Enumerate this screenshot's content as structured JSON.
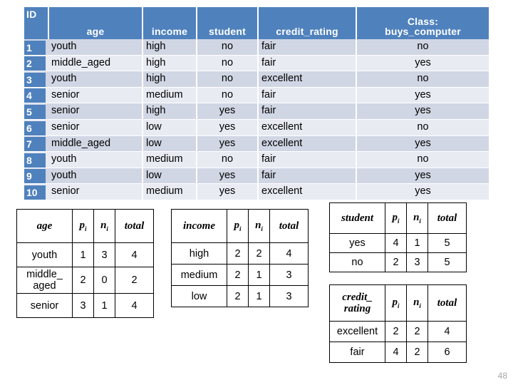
{
  "slide": {
    "page_number": "48"
  },
  "colors": {
    "header_blue": "#4F81BD",
    "row_odd": "#D1D6E4",
    "row_even": "#E9EBF3",
    "header_text": "#FFFFFF",
    "page_number_gray": "#A6A6A6",
    "border_black": "#000000"
  },
  "main_table": {
    "headers": {
      "id": "ID",
      "age": "age",
      "income": "income",
      "student": "student",
      "credit_rating": "credit_rating",
      "class_line1": "Class:",
      "class_line2": "buys_computer"
    },
    "rows": [
      {
        "id": "1",
        "age": "youth",
        "income": "high",
        "student": "no",
        "credit_rating": "fair",
        "buys_computer": "no"
      },
      {
        "id": "2",
        "age": "middle_aged",
        "income": "high",
        "student": "no",
        "credit_rating": "fair",
        "buys_computer": "yes"
      },
      {
        "id": "3",
        "age": "youth",
        "income": "high",
        "student": "no",
        "credit_rating": "excellent",
        "buys_computer": "no"
      },
      {
        "id": "4",
        "age": "senior",
        "income": "medium",
        "student": "no",
        "credit_rating": "fair",
        "buys_computer": "yes"
      },
      {
        "id": "5",
        "age": "senior",
        "income": "high",
        "student": "yes",
        "credit_rating": "fair",
        "buys_computer": "yes"
      },
      {
        "id": "6",
        "age": "senior",
        "income": "low",
        "student": "yes",
        "credit_rating": "excellent",
        "buys_computer": "no"
      },
      {
        "id": "7",
        "age": "middle_aged",
        "income": "low",
        "student": "yes",
        "credit_rating": "excellent",
        "buys_computer": "yes"
      },
      {
        "id": "8",
        "age": "youth",
        "income": "medium",
        "student": "no",
        "credit_rating": "fair",
        "buys_computer": "no"
      },
      {
        "id": "9",
        "age": "youth",
        "income": "low",
        "student": "yes",
        "credit_rating": "fair",
        "buys_computer": "yes"
      },
      {
        "id": "10",
        "age": "senior",
        "income": "medium",
        "student": "yes",
        "credit_rating": "excellent",
        "buys_computer": "yes"
      }
    ]
  },
  "summary_tables": {
    "common_headers": {
      "p": "p",
      "n": "n",
      "p_sub": "i",
      "n_sub": "i",
      "total": "total"
    },
    "age": {
      "attribute_label": "age",
      "rows": [
        {
          "label": "youth",
          "p": "1",
          "n": "3",
          "total": "4"
        },
        {
          "label": "middle_ aged",
          "p": "2",
          "n": "0",
          "total": "2"
        },
        {
          "label": "senior",
          "p": "3",
          "n": "1",
          "total": "4"
        }
      ]
    },
    "income": {
      "attribute_label": "income",
      "rows": [
        {
          "label": "high",
          "p": "2",
          "n": "2",
          "total": "4"
        },
        {
          "label": "medium",
          "p": "2",
          "n": "1",
          "total": "3"
        },
        {
          "label": "low",
          "p": "2",
          "n": "1",
          "total": "3"
        }
      ]
    },
    "student": {
      "attribute_label": "student",
      "rows": [
        {
          "label": "yes",
          "p": "4",
          "n": "1",
          "total": "5"
        },
        {
          "label": "no",
          "p": "2",
          "n": "3",
          "total": "5"
        }
      ]
    },
    "credit_rating": {
      "attribute_label_line1": "credit_",
      "attribute_label_line2": "rating",
      "rows": [
        {
          "label": "excellent",
          "p": "2",
          "n": "2",
          "total": "4"
        },
        {
          "label": "fair",
          "p": "4",
          "n": "2",
          "total": "6"
        }
      ]
    }
  }
}
